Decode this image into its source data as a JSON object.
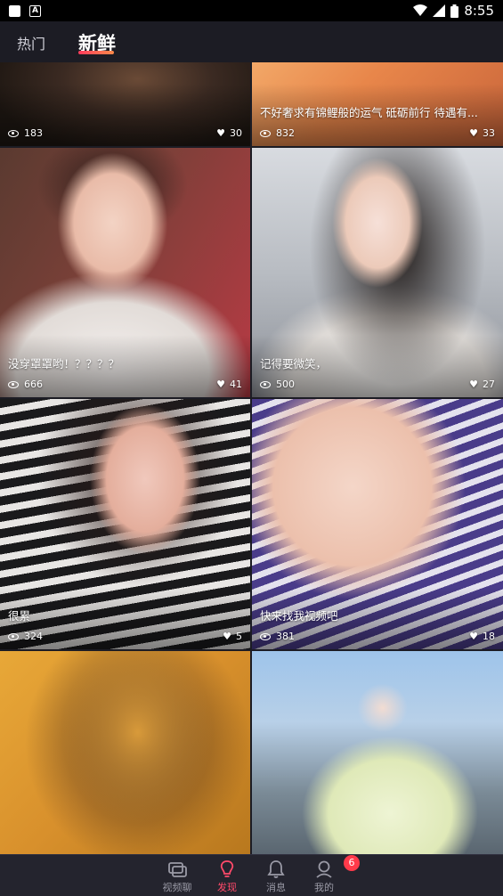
{
  "status_bar": {
    "time": "8:55"
  },
  "header": {
    "tabs": [
      {
        "label": "热门",
        "active": false
      },
      {
        "label": "新鲜",
        "active": true
      }
    ]
  },
  "cards": [
    {
      "caption": "",
      "views": "183",
      "likes": "30"
    },
    {
      "caption": "不好奢求有锦鲤般的运气 砥砺前行 待遇有...",
      "views": "832",
      "likes": "33"
    },
    {
      "caption": "没穿罩罩哟！？？？？",
      "views": "666",
      "likes": "41"
    },
    {
      "caption": "记得要微笑，",
      "views": "500",
      "likes": "27"
    },
    {
      "caption": "很累",
      "views": "324",
      "likes": "5"
    },
    {
      "caption": "快来找我视频吧",
      "views": "381",
      "likes": "18"
    },
    {
      "caption": "",
      "views": "",
      "likes": ""
    },
    {
      "caption": "",
      "views": "",
      "likes": ""
    }
  ],
  "bottom_nav": {
    "items": [
      {
        "label": "视频聊",
        "icon": "video-chat-icon"
      },
      {
        "label": "发现",
        "icon": "lightbulb-icon"
      },
      {
        "label": "消息",
        "icon": "bell-icon"
      },
      {
        "label": "我的",
        "icon": "user-icon"
      }
    ],
    "badge": "6"
  },
  "colors": {
    "accent": "#ff4a6a",
    "background": "#1c1c24"
  }
}
